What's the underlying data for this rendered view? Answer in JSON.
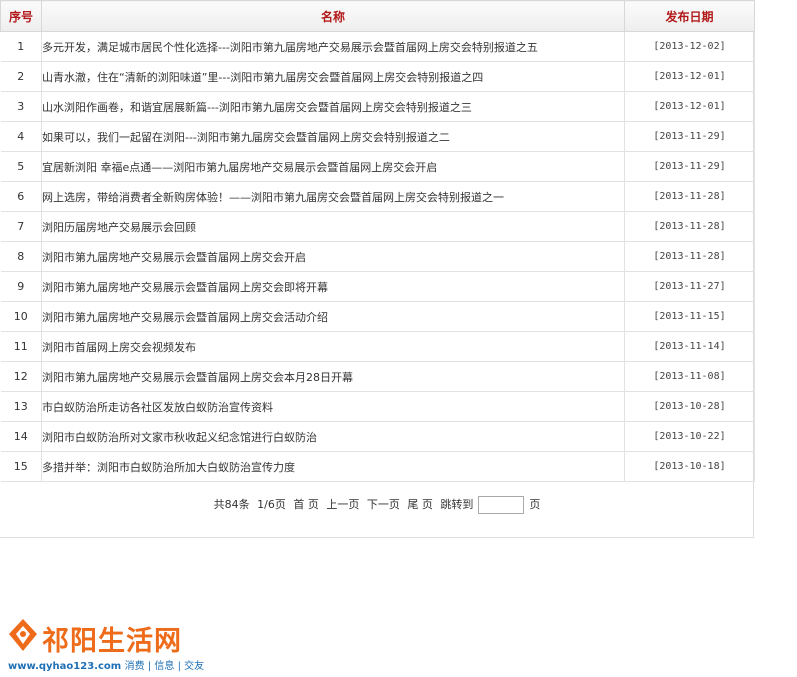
{
  "table": {
    "headers": {
      "idx": "序号",
      "name": "名称",
      "date": "发布日期"
    },
    "rows": [
      {
        "idx": "1",
        "name": "多元开发，满足城市居民个性化选择---浏阳市第九届房地产交易展示会暨首届网上房交会特别报道之五",
        "date": "[2013-12-02]"
      },
      {
        "idx": "2",
        "name": "山青水澈，住在“清新的浏阳味道”里---浏阳市第九届房交会暨首届网上房交会特别报道之四",
        "date": "[2013-12-01]"
      },
      {
        "idx": "3",
        "name": "山水浏阳作画卷，和谐宜居展新篇---浏阳市第九届房交会暨首届网上房交会特别报道之三",
        "date": "[2013-12-01]"
      },
      {
        "idx": "4",
        "name": "如果可以，我们一起留在浏阳---浏阳市第九届房交会暨首届网上房交会特别报道之二",
        "date": "[2013-11-29]"
      },
      {
        "idx": "5",
        "name": "宜居新浏阳 幸福e点通——浏阳市第九届房地产交易展示会暨首届网上房交会开启",
        "date": "[2013-11-29]"
      },
      {
        "idx": "6",
        "name": "网上选房，带给消费者全新购房体验！——浏阳市第九届房交会暨首届网上房交会特别报道之一",
        "date": "[2013-11-28]"
      },
      {
        "idx": "7",
        "name": "浏阳历届房地产交易展示会回顾",
        "date": "[2013-11-28]"
      },
      {
        "idx": "8",
        "name": "浏阳市第九届房地产交易展示会暨首届网上房交会开启",
        "date": "[2013-11-28]"
      },
      {
        "idx": "9",
        "name": "浏阳市第九届房地产交易展示会暨首届网上房交会即将开幕",
        "date": "[2013-11-27]"
      },
      {
        "idx": "10",
        "name": "浏阳市第九届房地产交易展示会暨首届网上房交会活动介绍",
        "date": "[2013-11-15]"
      },
      {
        "idx": "11",
        "name": "浏阳市首届网上房交会视频发布",
        "date": "[2013-11-14]"
      },
      {
        "idx": "12",
        "name": "浏阳市第九届房地产交易展示会暨首届网上房交会本月28日开幕",
        "date": "[2013-11-08]"
      },
      {
        "idx": "13",
        "name": "市白蚁防治所走访各社区发放白蚁防治宣传资料",
        "date": "[2013-10-28]"
      },
      {
        "idx": "14",
        "name": "浏阳市白蚁防治所对文家市秋收起义纪念馆进行白蚁防治",
        "date": "[2013-10-22]"
      },
      {
        "idx": "15",
        "name": "多措并举：浏阳市白蚁防治所加大白蚁防治宣传力度",
        "date": "[2013-10-18]"
      }
    ]
  },
  "pager": {
    "total": "共84条",
    "page": "1/6页",
    "first": "首 页",
    "prev": "上一页",
    "next": "下一页",
    "last": "尾 页",
    "jump": "跳转到",
    "jump_value": "",
    "unit": "页"
  },
  "logo": {
    "text": "祁阳生活网",
    "url": "www.qyhao123.com",
    "tags": "消费 | 信息 | 交友",
    "color": "#ee6b1a"
  }
}
